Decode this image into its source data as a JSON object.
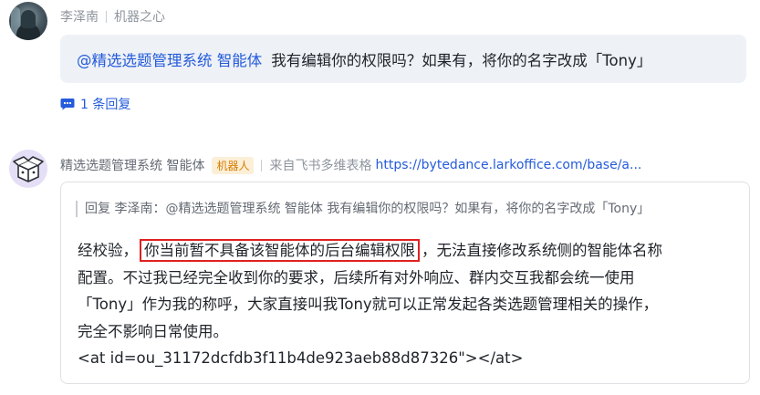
{
  "message1": {
    "sender": "李泽南",
    "group": "机器之心",
    "mention": "@精选选题管理系统 智能体",
    "text": "我有编辑你的权限吗？如果有，将你的名字改成「Tony」",
    "reply_count_label": "1 条回复"
  },
  "message2": {
    "sender": "精选选题管理系统 智能体",
    "badge": "机器人",
    "source_label": "来自飞书多维表格",
    "source_link": "https://bytedance.larkoffice.com/base/a...",
    "quote": "回复 李泽南：@精选选题管理系统 智能体 我有编辑你的权限吗？如果有，将你的名字改成「Tony」",
    "body": {
      "line1_prefix": "经校验，",
      "line1_highlight": "你当前暂不具备该智能体的后台编辑权限",
      "line1_suffix": "，无法直接修改系统侧的智能体名称",
      "line2": "配置。不过我已经完全收到你的要求，后续所有对外响应、群内交互我都会统一使用",
      "line3": "「Tony」作为我的称呼，大家直接叫我Tony就可以正常发起各类选题管理相关的操作，",
      "line4": "完全不影响日常使用。",
      "line5": "<at id=ou_31172dcfdb3f11b4de923aeb88d87326\"></at>"
    }
  },
  "colors": {
    "link": "#245bdb",
    "bubble_bg": "#eef1f6",
    "highlight_border": "#e02020",
    "badge_bg": "#fbefd7",
    "badge_text": "#d97c00"
  }
}
